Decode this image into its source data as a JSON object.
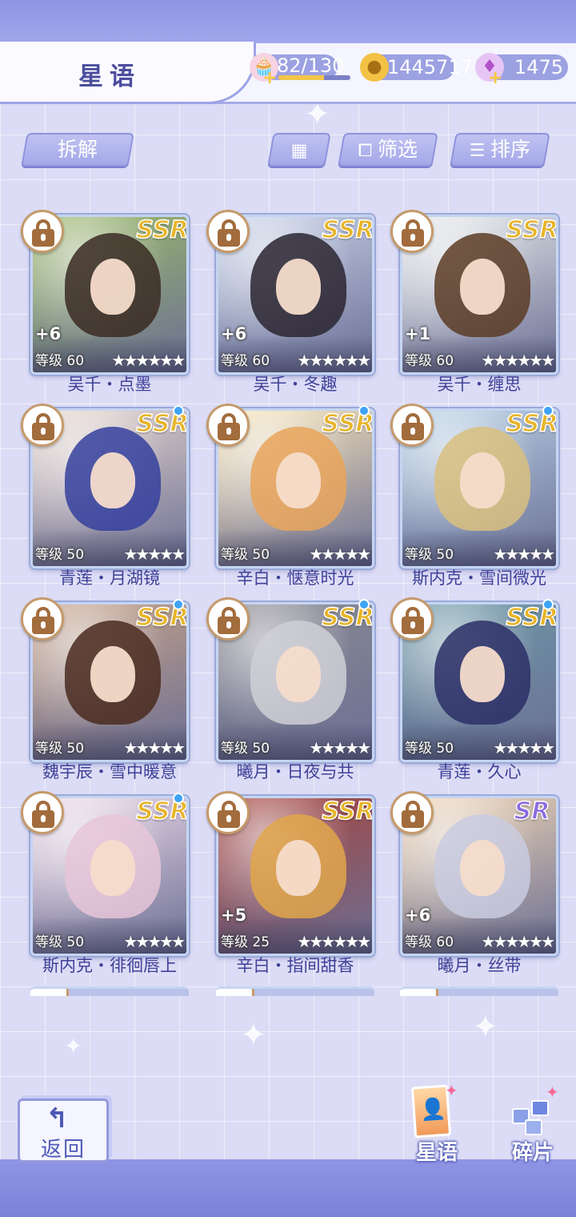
{
  "header": {
    "title": "星语",
    "stamina": "82/130",
    "stamina_fraction": 0.63,
    "coins": "1445717",
    "diamonds": "1475"
  },
  "toolbar": {
    "disassemble": "拆解",
    "filter": "筛选",
    "sort": "排序"
  },
  "cards": [
    {
      "name": "吴千・点墨",
      "level": "等级 60",
      "plus": "+6",
      "rarity": "SSR",
      "stars": 6,
      "new": false,
      "hair": "#3a2a22",
      "bg": "#9dbb6a"
    },
    {
      "name": "吴千・冬趣",
      "level": "等级 60",
      "plus": "+6",
      "rarity": "SSR",
      "stars": 6,
      "new": false,
      "hair": "#2a2430",
      "bg": "#c9d3ea"
    },
    {
      "name": "吴千・缠思",
      "level": "等级 60",
      "plus": "+1",
      "rarity": "SSR",
      "stars": 6,
      "new": false,
      "hair": "#5a3b25",
      "bg": "#e8ecec"
    },
    {
      "name": "青莲・月湖镜",
      "level": "等级 50",
      "plus": "",
      "rarity": "SSR",
      "stars": 5,
      "new": true,
      "hair": "#35409e",
      "bg": "#ead9cf"
    },
    {
      "name": "辛白・惬意时光",
      "level": "等级 50",
      "plus": "",
      "rarity": "SSR",
      "stars": 5,
      "new": true,
      "hair": "#e9a45a",
      "bg": "#fbe7b9"
    },
    {
      "name": "斯内克・雪间微光",
      "level": "等级 50",
      "plus": "",
      "rarity": "SSR",
      "stars": 5,
      "new": true,
      "hair": "#d9c07f",
      "bg": "#b9d3e8"
    },
    {
      "name": "魏宇辰・雪中暖意",
      "level": "等级 50",
      "plus": "",
      "rarity": "SSR",
      "stars": 5,
      "new": true,
      "hair": "#4a2a1e",
      "bg": "#c9a488"
    },
    {
      "name": "曦月・日夜与共",
      "level": "等级 50",
      "plus": "",
      "rarity": "SSR",
      "stars": 5,
      "new": true,
      "hair": "#cfcfd6",
      "bg": "#8c8c92"
    },
    {
      "name": "青莲・久心",
      "level": "等级 50",
      "plus": "",
      "rarity": "SSR",
      "stars": 5,
      "new": true,
      "hair": "#2b2f66",
      "bg": "#6e9aa8"
    },
    {
      "name": "斯内克・徘徊唇上",
      "level": "等级 50",
      "plus": "",
      "rarity": "SSR",
      "stars": 5,
      "new": true,
      "hair": "#e6c6d8",
      "bg": "#f1dcea"
    },
    {
      "name": "辛白・指间甜香",
      "level": "等级 25",
      "plus": "+5",
      "rarity": "SSR",
      "stars": 6,
      "new": false,
      "hair": "#e0a64a",
      "bg": "#a8423a"
    },
    {
      "name": "曦月・丝带",
      "level": "等级 60",
      "plus": "+6",
      "rarity": "SR",
      "stars": 6,
      "new": false,
      "hair": "#c9cbe0",
      "bg": "#f2d7b5"
    }
  ],
  "footer": {
    "back": "返回",
    "nav_cards": "星语",
    "nav_fragments": "碎片"
  }
}
